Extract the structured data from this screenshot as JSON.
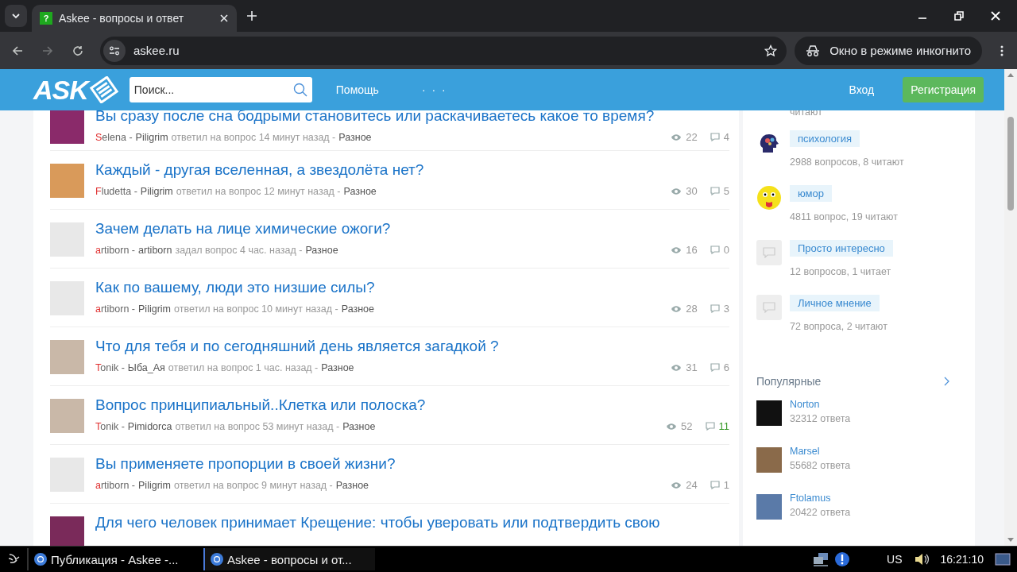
{
  "browser": {
    "tab": {
      "title": "Askee - вопросы и ответ",
      "favicon": "?"
    },
    "url": "askee.ru",
    "incognito": "Окно в режиме инкогнито"
  },
  "header": {
    "logo": "ASK",
    "search": {
      "placeholder": "Поиск..."
    },
    "nav": [
      "Помощь",
      "· · ·"
    ],
    "login": "Вход",
    "register": "Регистрация"
  },
  "questions": [
    {
      "title": "Вы сразу после сна бодрыми становитесь или раскачиваетесь какое то время?",
      "author": "Selena -",
      "user": "Piligrim",
      "action": "ответил на вопрос 14 минут назад -",
      "category": "Разное",
      "views": "22",
      "answers": "4",
      "highlighted": false
    },
    {
      "title": "Каждый - другая вселенная, а звездолёта нет?",
      "author": "Fludetta -",
      "user": "Piligrim",
      "action": "ответил на вопрос 12 минут назад -",
      "category": "Разное",
      "views": "30",
      "answers": "5",
      "highlighted": false
    },
    {
      "title": "Зачем делать на лице химические ожоги?",
      "author": "artiborn -",
      "user": "artiborn",
      "action": "задал вопрос 4 час. назад -",
      "category": "Разное",
      "views": "16",
      "answers": "0",
      "highlighted": false
    },
    {
      "title": "Как по вашему, люди это низшие силы?",
      "author": "artiborn -",
      "user": "Piligrim",
      "action": "ответил на вопрос 10 минут назад -",
      "category": "Разное",
      "views": "28",
      "answers": "3",
      "highlighted": false
    },
    {
      "title": "Что для тебя и по сегодняшний день является загадкой ?",
      "author": "Tonik -",
      "user": "Ыба_Ая",
      "action": "ответил на вопрос 1 час. назад -",
      "category": "Разное",
      "views": "31",
      "answers": "6",
      "highlighted": false
    },
    {
      "title": "Вопрос принципиальный..Клетка или полоска?",
      "author": "Tonik -",
      "user": "Pimidorca",
      "action": "ответил на вопрос 53 минут назад -",
      "category": "Разное",
      "views": "52",
      "answers": "11",
      "highlighted": true
    },
    {
      "title": "Вы применяете пропорции в своей жизни?",
      "author": "artiborn -",
      "user": "Piligrim",
      "action": "ответил на вопрос 9 минут назад -",
      "category": "Разное",
      "views": "24",
      "answers": "1",
      "highlighted": false
    },
    {
      "title": "Для чего человек принимает Крещение: чтобы уверовать или подтвердить свою"
    }
  ],
  "sidebar": {
    "cut_text": "читают",
    "topics": [
      {
        "name": "психология",
        "stats": "2988 вопросов, 8 читают",
        "kind": "picture"
      },
      {
        "name": "юмор",
        "stats": "4811 вопрос, 19 читают",
        "kind": "smiley"
      },
      {
        "name": "Просто интересно",
        "stats": "12 вопросов, 1 читает",
        "kind": "plain"
      },
      {
        "name": "Личное мнение",
        "stats": "72 вопроса, 2 читают",
        "kind": "plain"
      }
    ],
    "popular": {
      "title": "Популярные",
      "users": [
        {
          "name": "Norton",
          "stats": "32312 ответа"
        },
        {
          "name": "Marsel",
          "stats": "55682 ответа"
        },
        {
          "name": "Ftolamus",
          "stats": "20422 ответа"
        }
      ]
    }
  },
  "taskbar": {
    "tasks": [
      {
        "label": "Публикация - Askee -...",
        "selected": false
      },
      {
        "label": "Askee - вопросы и от...",
        "selected": true
      }
    ],
    "lang": "US",
    "clock": "16:21:10"
  }
}
